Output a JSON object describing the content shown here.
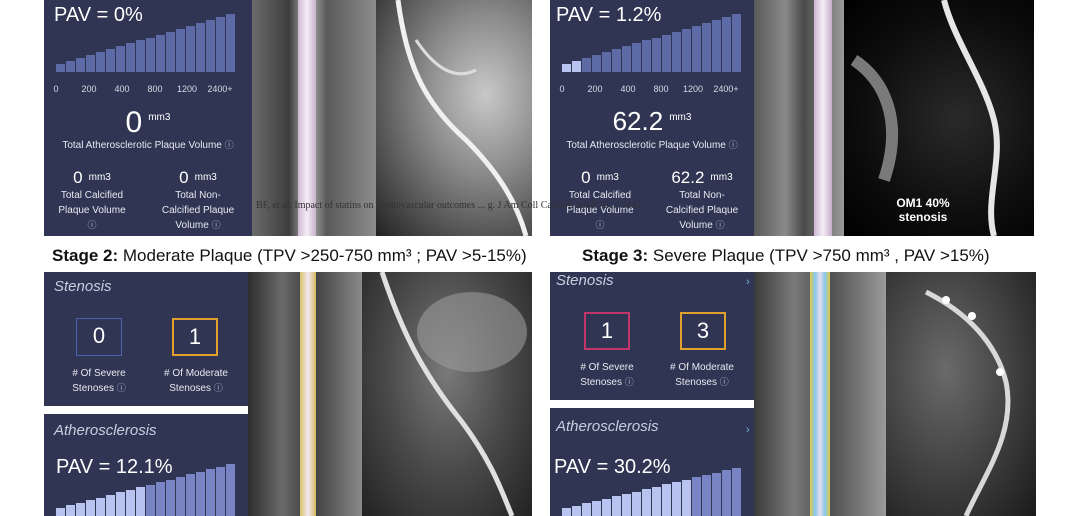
{
  "colors": {
    "panel_bg": "#2f3552",
    "bar_fill": "#5c6aa6",
    "bar_active": "#b9c3ef",
    "severe_box": "#c2356b",
    "moderate_box": "#e0a030",
    "zero_box": "#4a63b0"
  },
  "top_left": {
    "pav": "PAV = 0%",
    "ticks": [
      "0",
      "200",
      "400",
      "800",
      "1200",
      "2400+"
    ],
    "total_value": "0",
    "total_unit": "mm3",
    "total_label": "Total Atherosclerotic Plaque Volume",
    "calcified_value": "0",
    "calcified_unit": "mm3",
    "calcified_label_1": "Total Calcified",
    "calcified_label_2": "Plaque Volume",
    "noncalcified_value": "0",
    "noncalcified_unit": "mm3",
    "noncalcified_label_1": "Total Non-",
    "noncalcified_label_2": "Calcified Plaque",
    "noncalcified_label_3": "Volume",
    "info": "ⓘ",
    "active_fraction": 0.0
  },
  "top_right": {
    "pav": "PAV = 1.2%",
    "ticks": [
      "0",
      "200",
      "400",
      "800",
      "1200",
      "2400+"
    ],
    "total_value": "62.2",
    "total_unit": "mm3",
    "total_label": "Total Atherosclerotic Plaque Volume",
    "calcified_value": "0",
    "calcified_unit": "mm3",
    "calcified_label_1": "Total Calcified",
    "calcified_label_2": "Plaque Volume",
    "noncalcified_value": "62.2",
    "noncalcified_unit": "mm3",
    "noncalcified_label_1": "Total Non-",
    "noncalcified_label_2": "Calcified Plaque",
    "noncalcified_label_3": "Volume",
    "info": "ⓘ",
    "active_fraction": 0.1
  },
  "citation": "BF, et al. Impact of statins on cardiovascular outcomes ... g. J Am Coll Cardiol. 2018;72 ... 3242",
  "om1_annotation": {
    "line1": "OM1 40%",
    "line2": "stenosis"
  },
  "stage2": {
    "label": "Stage 2:",
    "text": "Moderate Plaque (TPV >250-750 mm³ ; PAV >5-15%)"
  },
  "stage3": {
    "label": "Stage 3:",
    "text": "Severe Plaque (TPV >750 mm³ , PAV >15%)"
  },
  "bottom_left": {
    "stenosis_title": "Stenosis",
    "severe_count": "0",
    "severe_label_1": "# Of Severe",
    "severe_label_2": "Stenoses",
    "moderate_count": "1",
    "moderate_label_1": "# Of Moderate",
    "moderate_label_2": "Stenoses",
    "athero_title": "Atherosclerosis",
    "pav": "PAV = 12.1%",
    "info": "ⓘ"
  },
  "bottom_right": {
    "stenosis_title": "Stenosis",
    "severe_count": "1",
    "severe_label_1": "# Of Severe",
    "severe_label_2": "Stenoses",
    "moderate_count": "3",
    "moderate_label_1": "# Of Moderate",
    "moderate_label_2": "Stenoses",
    "athero_title": "Atherosclerosis",
    "pav": "PAV = 30.2%",
    "info": "ⓘ",
    "chevron": "›"
  }
}
